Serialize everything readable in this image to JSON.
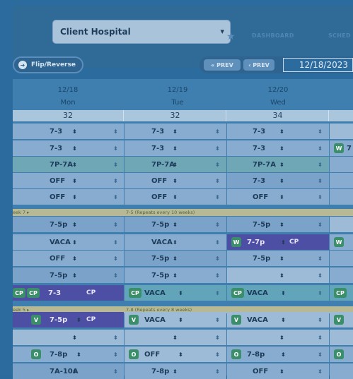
{
  "header": {
    "hospital_select_value": "Client Hospital",
    "nav_dashboard": "DASHBOARD",
    "nav_sched": "SCHED"
  },
  "toolbar": {
    "flip_label": "Flip/Reverse",
    "prev_fast_label": "« PREV",
    "prev_label": "‹ PREV",
    "date_value": "12/18/2023"
  },
  "days": [
    {
      "date": "12/18",
      "dow": "Mon",
      "count": "32"
    },
    {
      "date": "12/19",
      "dow": "Tue",
      "count": "32"
    },
    {
      "date": "12/20",
      "dow": "Wed",
      "count": "34"
    }
  ],
  "separators": {
    "sep1_left": "eek 7 ▸",
    "sep1_mid": "7-5  (Repeats every 10 weeks)",
    "sep2_left": "eek 5 ▸",
    "sep2_mid": "7-8  (Repeats every 8 weeks)"
  },
  "rows": [
    {
      "mon": "7-3",
      "tue": "7-3",
      "wed": "7-3"
    },
    {
      "mon": "7-3",
      "tue": "7-3",
      "wed": "7-3",
      "thu_badge": "W",
      "thu_text": "7"
    },
    {
      "mon": "7P-7A",
      "tue": "7P-7A",
      "wed": "7P-7A"
    },
    {
      "mon": "OFF",
      "tue": "OFF",
      "wed": "7-3"
    },
    {
      "mon": "OFF",
      "tue": "OFF",
      "wed": "OFF"
    },
    {
      "mon": "7-5p",
      "tue": "7-5p",
      "wed": "7-5p"
    },
    {
      "mon": "VACA",
      "tue": "VACA",
      "wed_badge": "W",
      "wed": "7-7p",
      "wed_tag": "CP",
      "thu_badge": "W"
    },
    {
      "mon": "OFF",
      "tue": "7-5p",
      "wed": "7-5p"
    },
    {
      "mon": "7-5p",
      "tue": "7-5p",
      "wed": ""
    },
    {
      "mon_badge_a": "CP",
      "mon_badge_b": "CP",
      "mon": "7-3",
      "mon_tag": "CP",
      "tue_badge": "CP",
      "tue": "VACA",
      "wed_badge": "CP",
      "wed": "VACA",
      "thu_badge": "CP"
    },
    {
      "mon_badge": "V",
      "mon": "7-5p",
      "mon_tag": "CP",
      "tue_badge": "V",
      "tue": "VACA",
      "wed_badge": "V",
      "wed": "VACA",
      "thu_badge": "V"
    },
    {
      "mon": "",
      "tue": "",
      "wed": ""
    },
    {
      "mon_badge": "O",
      "mon": "7-8p",
      "tue_badge": "O",
      "tue": "OFF",
      "wed_badge": "O",
      "wed": "7-8p",
      "thu_badge": "O"
    },
    {
      "mon": "7A-10A",
      "tue": "7-8p",
      "wed": "OFF"
    }
  ],
  "icons": {
    "arrow": "⬍",
    "star": "★",
    "chevron": "˅"
  },
  "colors": {
    "overlay": "#2c6b9e",
    "purple": "#4d4fa4",
    "green_badge": "#3a8f6a"
  }
}
